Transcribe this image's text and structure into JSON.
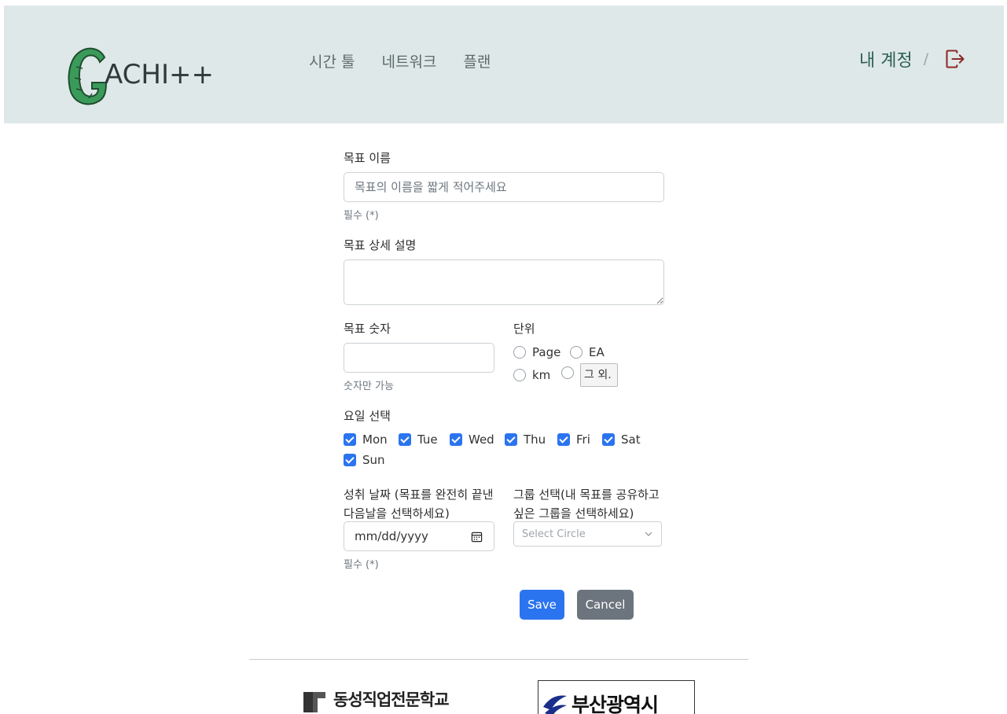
{
  "header": {
    "logo_text": "ACHI++",
    "nav": [
      "시간 툴",
      "네트워크",
      "플랜"
    ],
    "account_label": "내 계정",
    "separator": "/"
  },
  "form": {
    "goal_name": {
      "label": "목표 이름",
      "placeholder": "목표의 이름을 짧게 적어주세요",
      "hint": "필수 (*)"
    },
    "goal_desc": {
      "label": "목표 상세 설명"
    },
    "goal_number": {
      "label": "목표 숫자",
      "hint": "숫자만 가능"
    },
    "unit": {
      "label": "단위",
      "options": [
        "Page",
        "EA",
        "km"
      ],
      "other_value": "그 외."
    },
    "days": {
      "label": "요일 선택",
      "items": [
        "Mon",
        "Tue",
        "Wed",
        "Thu",
        "Fri",
        "Sat",
        "Sun"
      ],
      "checked": [
        true,
        true,
        true,
        true,
        true,
        true,
        true
      ]
    },
    "date": {
      "label": "성취 날짜 (목표를 완전히 끝낸 다음날을 선택하세요)",
      "placeholder": "mm/dd/yyyy",
      "hint": "필수 (*)"
    },
    "group": {
      "label": "그룹 선택(내 목표를 공유하고 싶은 그룹을 선택하세요)",
      "placeholder": "Select Circle"
    },
    "save_label": "Save",
    "cancel_label": "Cancel"
  },
  "footer": {
    "sponsor1": "동성직업전문학교",
    "sponsor2": "부산광역시"
  },
  "colors": {
    "header_bg": "#dfe8e8",
    "primary": "#2b74f0",
    "secondary": "#6c757d",
    "account": "#2a6150",
    "logout_icon": "#8b2c2c",
    "logo_green": "#3a9a5a"
  }
}
